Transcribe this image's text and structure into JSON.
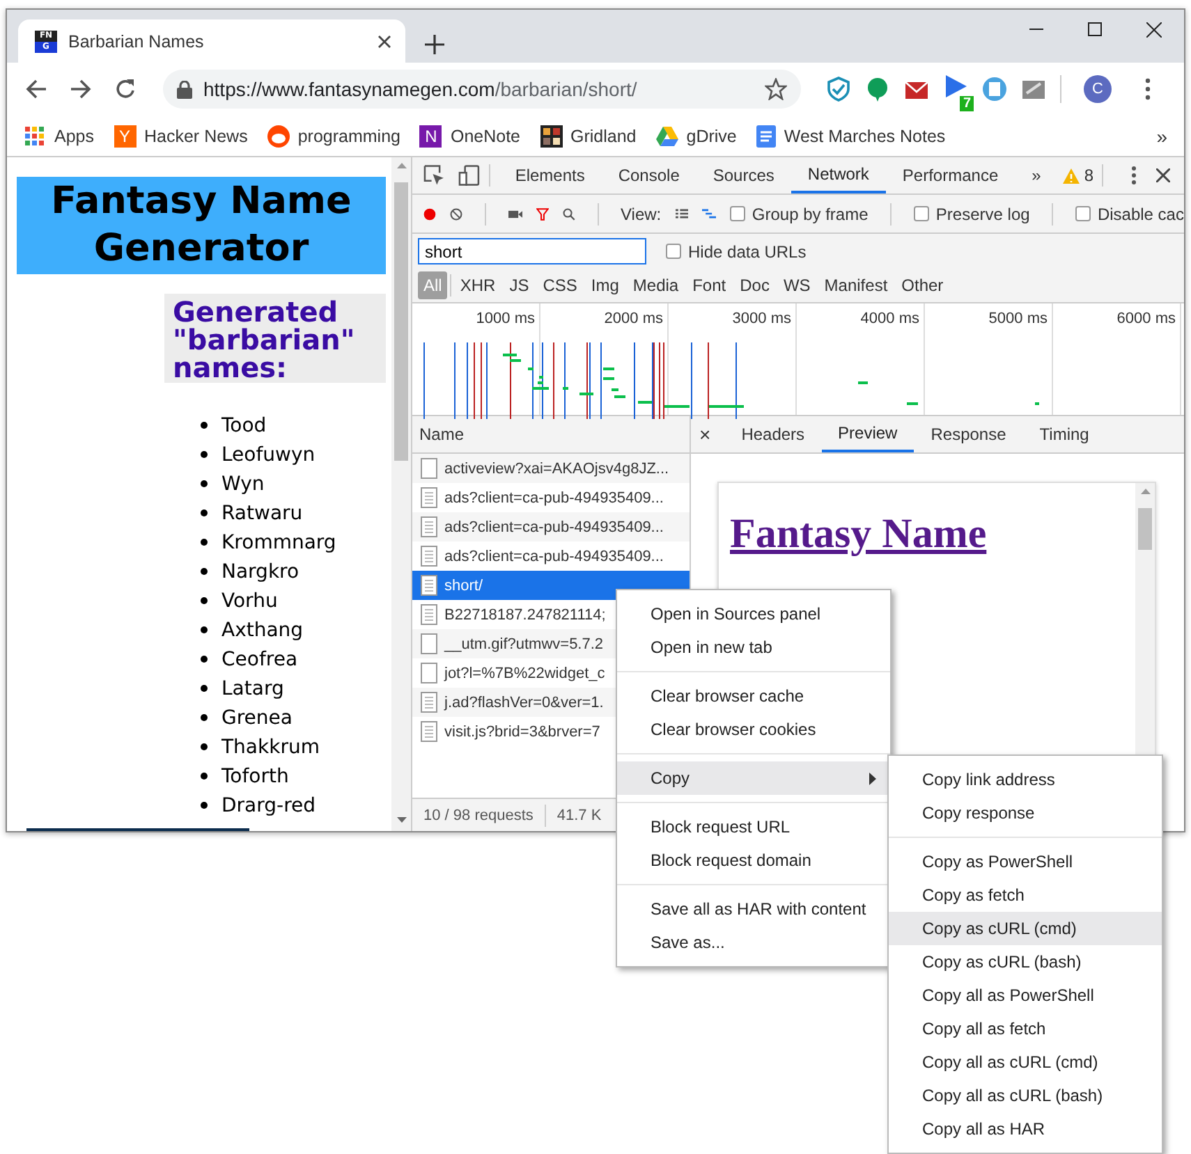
{
  "browser_tab": {
    "title": "Barbarian Names",
    "favicon_text": [
      "FN",
      "G"
    ]
  },
  "address_bar": {
    "host": "https://www.fantasynamegen.com",
    "path": "/barbarian/short/"
  },
  "extension_badge": "7",
  "profile_initial": "C",
  "bookmarks": [
    {
      "label": "Apps",
      "kind": "apps"
    },
    {
      "label": "Hacker News",
      "kind": "letter",
      "icon_text": "Y"
    },
    {
      "label": "programming",
      "kind": "reddit"
    },
    {
      "label": "OneNote",
      "kind": "letter-purple",
      "icon_text": "N"
    },
    {
      "label": "Gridland",
      "kind": "grid"
    },
    {
      "label": "gDrive",
      "kind": "drive"
    },
    {
      "label": "West Marches Notes",
      "kind": "docs"
    }
  ],
  "bookmarks_more": "»",
  "page": {
    "title": "Fantasy Name Generator",
    "subtitle": "Generated \"barbarian\" names:",
    "names": [
      "Tood",
      "Leofuwyn",
      "Wyn",
      "Ratwaru",
      "Krommnarg",
      "Nargkro",
      "Vorhu",
      "Axthang",
      "Ceofrea",
      "Latarg",
      "Grenea",
      "Thakkrum",
      "Toforth",
      "Drarg-red"
    ]
  },
  "devtools": {
    "tabs": [
      {
        "label": "Elements",
        "selected": false
      },
      {
        "label": "Console",
        "selected": false
      },
      {
        "label": "Sources",
        "selected": false
      },
      {
        "label": "Network",
        "selected": true
      },
      {
        "label": "Performance",
        "selected": false
      }
    ],
    "more_tabs": "»",
    "warning_count": "8",
    "recording": true,
    "view_label": "View:",
    "toolbar_checkboxes": [
      {
        "label": "Group by frame",
        "checked": false
      },
      {
        "label": "Preserve log",
        "checked": false
      },
      {
        "label": "Disable cac",
        "checked": false
      }
    ],
    "filter": {
      "value": "short"
    },
    "hide_data_urls": {
      "label": "Hide data URLs",
      "checked": false
    },
    "type_filters": [
      {
        "label": "All",
        "selected": true
      },
      {
        "label": "XHR",
        "selected": false
      },
      {
        "label": "JS",
        "selected": false
      },
      {
        "label": "CSS",
        "selected": false
      },
      {
        "label": "Img",
        "selected": false
      },
      {
        "label": "Media",
        "selected": false
      },
      {
        "label": "Font",
        "selected": false
      },
      {
        "label": "Doc",
        "selected": false
      },
      {
        "label": "WS",
        "selected": false
      },
      {
        "label": "Manifest",
        "selected": false
      },
      {
        "label": "Other",
        "selected": false
      }
    ],
    "overview_ticks": [
      "1000 ms",
      "2000 ms",
      "3000 ms",
      "4000 ms",
      "5000 ms",
      "6000 ms"
    ],
    "name_column": "Name",
    "requests": [
      {
        "name": "activeview?xai=AKAOjsv4g8JZ...",
        "kind": "blank",
        "selected": false
      },
      {
        "name": "ads?client=ca-pub-494935409...",
        "kind": "doc",
        "selected": false
      },
      {
        "name": "ads?client=ca-pub-494935409...",
        "kind": "doc",
        "selected": false
      },
      {
        "name": "ads?client=ca-pub-494935409...",
        "kind": "doc",
        "selected": false
      },
      {
        "name": "short/",
        "kind": "doc",
        "selected": true
      },
      {
        "name": "B22718187.247821114;",
        "kind": "doc",
        "selected": false
      },
      {
        "name": "__utm.gif?utmwv=5.7.2",
        "kind": "blank",
        "selected": false
      },
      {
        "name": "jot?l=%7B%22widget_c",
        "kind": "blank",
        "selected": false
      },
      {
        "name": "j.ad?flashVer=0&ver=1.",
        "kind": "doc",
        "selected": false
      },
      {
        "name": "visit.js?brid=3&brver=7",
        "kind": "doc",
        "selected": false
      }
    ],
    "status": {
      "requests": "10 / 98 requests",
      "size": "41.7 K"
    },
    "detail_close": "×",
    "detail_tabs": [
      {
        "label": "Headers",
        "selected": false
      },
      {
        "label": "Preview",
        "selected": true
      },
      {
        "label": "Response",
        "selected": false
      },
      {
        "label": "Timing",
        "selected": false
      }
    ],
    "preview_heading": "Fantasy Name"
  },
  "context_menu": [
    [
      {
        "label": "Open in Sources panel",
        "highlighted": false
      },
      {
        "label": "Open in new tab",
        "highlighted": false
      }
    ],
    [
      {
        "label": "Clear browser cache",
        "highlighted": false
      },
      {
        "label": "Clear browser cookies",
        "highlighted": false
      }
    ],
    [
      {
        "label": "Copy",
        "highlighted": true,
        "submenu": true
      }
    ],
    [
      {
        "label": "Block request URL",
        "highlighted": false
      },
      {
        "label": "Block request domain",
        "highlighted": false
      }
    ],
    [
      {
        "label": "Save all as HAR with content",
        "highlighted": false
      },
      {
        "label": "Save as...",
        "highlighted": false
      }
    ]
  ],
  "copy_submenu": [
    [
      {
        "label": "Copy link address",
        "highlighted": false
      },
      {
        "label": "Copy response",
        "highlighted": false
      }
    ],
    [
      {
        "label": "Copy as PowerShell",
        "highlighted": false
      },
      {
        "label": "Copy as fetch",
        "highlighted": false
      },
      {
        "label": "Copy as cURL (cmd)",
        "highlighted": true
      },
      {
        "label": "Copy as cURL (bash)",
        "highlighted": false
      },
      {
        "label": "Copy all as PowerShell",
        "highlighted": false
      },
      {
        "label": "Copy all as fetch",
        "highlighted": false
      },
      {
        "label": "Copy all as cURL (cmd)",
        "highlighted": false
      },
      {
        "label": "Copy all as cURL (bash)",
        "highlighted": false
      },
      {
        "label": "Copy all as HAR",
        "highlighted": false
      }
    ]
  ]
}
